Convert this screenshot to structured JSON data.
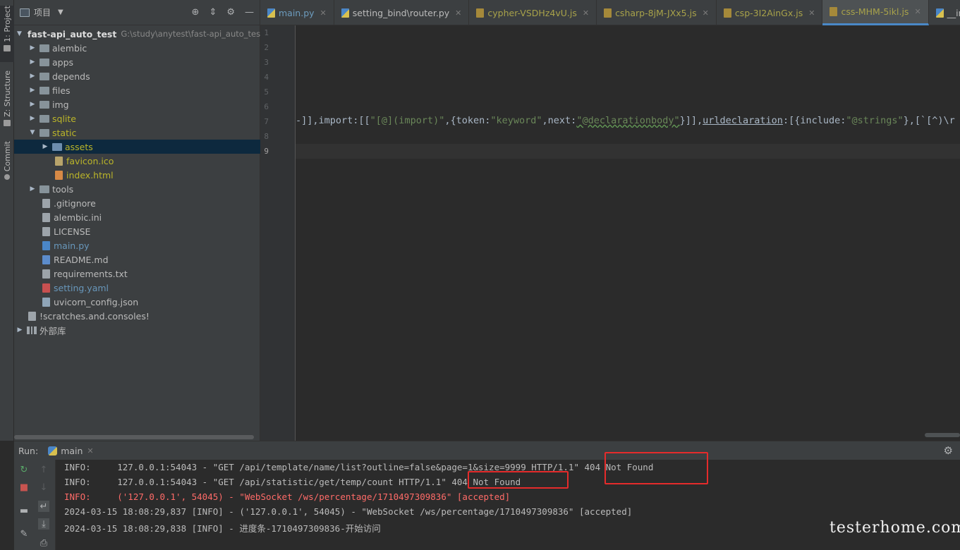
{
  "side_tabs": [
    {
      "label": "1: Project"
    },
    {
      "label": "Z: Structure"
    },
    {
      "label": "Commit"
    }
  ],
  "project": {
    "header_title": "项目",
    "tree": [
      {
        "label": "fast-api_auto_test",
        "path": "G:\\study\\anytest\\fast-api_auto_tes"
      },
      {
        "label": "alembic"
      },
      {
        "label": "apps"
      },
      {
        "label": "depends"
      },
      {
        "label": "files"
      },
      {
        "label": "img"
      },
      {
        "label": "sqlite"
      },
      {
        "label": "static"
      },
      {
        "label": "assets"
      },
      {
        "label": "favicon.ico"
      },
      {
        "label": "index.html"
      },
      {
        "label": "tools"
      },
      {
        "label": ".gitignore"
      },
      {
        "label": "alembic.ini"
      },
      {
        "label": "LICENSE"
      },
      {
        "label": "main.py"
      },
      {
        "label": "README.md"
      },
      {
        "label": "requirements.txt"
      },
      {
        "label": "setting.yaml"
      },
      {
        "label": "uvicorn_config.json"
      },
      {
        "label": "!scratches.and.consoles!"
      },
      {
        "label": "外部库"
      }
    ]
  },
  "editor_tabs": [
    {
      "label": "main.py"
    },
    {
      "label": "setting_bind\\router.py"
    },
    {
      "label": "cypher-VSDHz4vU.js"
    },
    {
      "label": "csharp-8jM-JXx5.js"
    },
    {
      "label": "csp-3I2AinGx.js"
    },
    {
      "label": "css-MHM-5ikl.js"
    },
    {
      "label": "__init__.py"
    }
  ],
  "editor": {
    "line_numbers": [
      "1",
      "2",
      "3",
      "4",
      "5",
      "6",
      "7",
      "8",
      "9"
    ],
    "code_parts": {
      "p1": "-]],import:[[",
      "s1": "\"[@](import)\"",
      "p2": ",{token:",
      "s2": "\"keyword\"",
      "p3": ",next:",
      "s3": "\"@declarationbody\"",
      "p4": "}]],",
      "p5": "urldeclaration",
      "p6": ":[{include:",
      "s4": "\"@strings\"",
      "p7": "},[`[^)\\r"
    }
  },
  "run": {
    "label": "Run:",
    "tab": "main",
    "lines": [
      "INFO:     127.0.0.1:54043 - \"GET /api/template/name/list?outline=false&page=1&size=9999 HTTP/1.1\" 404 Not Found",
      "INFO:     127.0.0.1:54043 - \"GET /api/statistic/get/temp/count HTTP/1.1\" 404 Not Found",
      "INFO:     ('127.0.0.1', 54045) - \"WebSocket /ws/percentage/1710497309836\" [accepted]",
      "2024-03-15 18:08:29,837 [INFO] - ('127.0.0.1', 54045) - \"WebSocket /ws/percentage/1710497309836\" [accepted]",
      "2024-03-15 18:08:29,838 [INFO] - 进度条-1710497309836-开始访问"
    ]
  },
  "watermark": "testerhome.com"
}
